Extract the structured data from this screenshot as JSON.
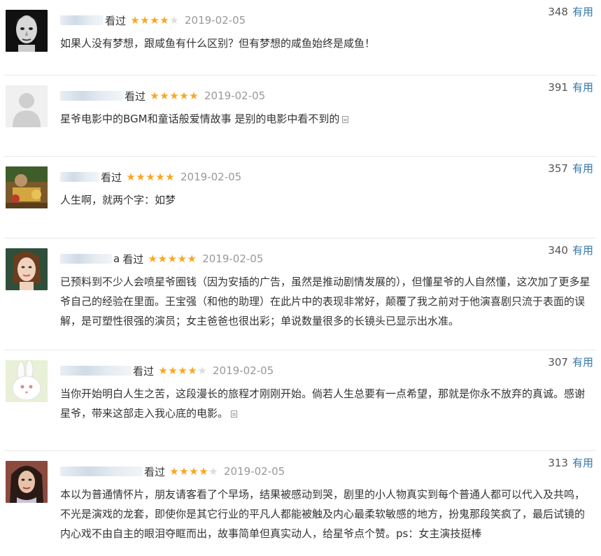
{
  "comments": [
    {
      "avatar": "bw-man-avatar",
      "watched_label": "看过",
      "rating": 4,
      "date": "2019-02-05",
      "votes": "348",
      "useful_label": "有用",
      "content": "如果人没有梦想，跟咸鱼有什么区别？但有梦想的咸鱼始终是咸鱼！",
      "has_more": false
    },
    {
      "avatar": "default-gray-avatar",
      "watched_label": "看过",
      "rating": 5,
      "date": "2019-02-05",
      "votes": "391",
      "useful_label": "有用",
      "content": "星爷电影中的BGM和童话般爱情故事 是别的电影中看不到的",
      "has_more": true
    },
    {
      "avatar": "food-photo-avatar",
      "watched_label": "看过",
      "rating": 5,
      "date": "2019-02-05",
      "votes": "357",
      "useful_label": "有用",
      "content": "人生啊，就两个字：如梦",
      "has_more": false
    },
    {
      "avatar": "woman-portrait-avatar",
      "username_suffix": "a",
      "watched_label": "看过",
      "rating": 5,
      "date": "2019-02-05",
      "votes": "340",
      "useful_label": "有用",
      "content": "已预料到不少人会喷星爷圈钱（因为安插的广告，虽然是推动剧情发展的），但懂星爷的人自然懂，这次加了更多星爷自己的经验在里面。王宝强（和他的助理）在此片中的表现非常好，颠覆了我之前对于他演喜剧只流于表面的误解，是可塑性很强的演员；女主爸爸也很出彩；单说数量很多的长镜头已显示出水准。",
      "has_more": false
    },
    {
      "avatar": "white-rabbit-avatar",
      "watched_label": "看过",
      "rating": 4,
      "date": "2019-02-05",
      "votes": "307",
      "useful_label": "有用",
      "content": "当你开始明白人生之苦，这段漫长的旅程才刚刚开始。倘若人生总要有一点希望，那就是你永不放弃的真诚。感谢星爷，带来这部走入我心底的电影。",
      "has_more": true
    },
    {
      "avatar": "dark-hair-woman-avatar",
      "watched_label": "看过",
      "rating": 4,
      "date": "2019-02-05",
      "votes": "313",
      "useful_label": "有用",
      "content": "本以为普通情怀片，朋友请客看了个早场，结果被感动到哭，剧里的小人物真实到每个普通人都可以代入及共鸣，不光是演戏的龙套，即使你是其它行业的平凡人都能被触及内心最柔软敏感的地方，扮鬼那段笑疯了，最后试镜的内心戏不由自主的眼泪夺眶而出，故事简单但真实动人，给星爷点个赞。ps：女主演技挺棒",
      "has_more": false
    }
  ],
  "colors": {
    "star_on": "#f7a722",
    "star_off": "#dcdcdc",
    "link": "#3377aa",
    "date": "#999999",
    "divider": "#e8e8e8"
  }
}
